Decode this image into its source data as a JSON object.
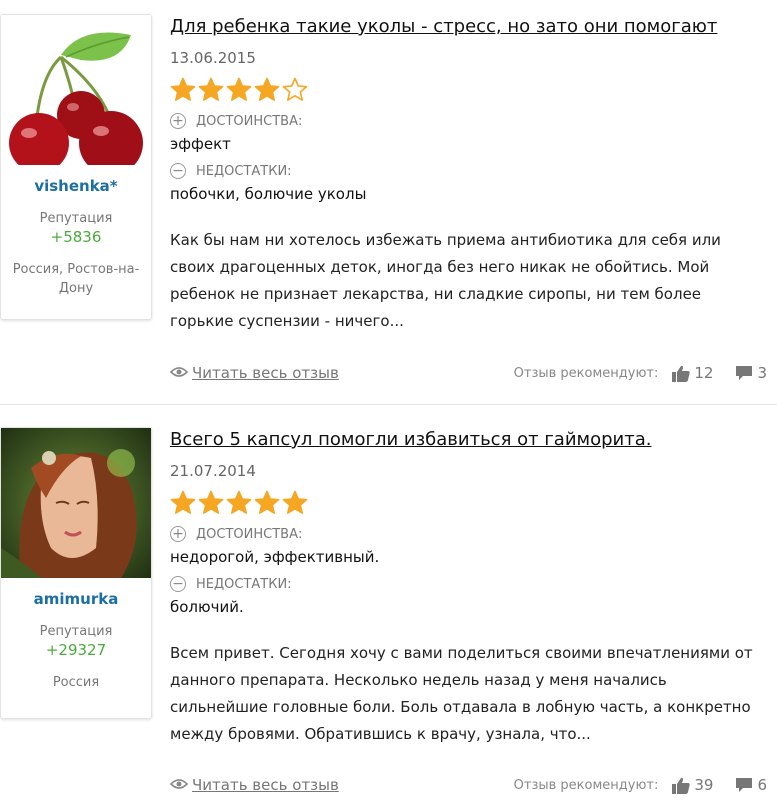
{
  "reviews": [
    {
      "user": {
        "name": "vishenka*",
        "rep_label": "Репутация",
        "rep_value": "+5836",
        "location": "Россия, Ростов-на-Дону",
        "avatar_icon": "cherry-avatar"
      },
      "title": "Для ребенка такие уколы - стресс, но зато они помогают",
      "date": "13.06.2015",
      "rating": 4,
      "rating_max": 5,
      "pros_label": "ДОСТОИНСТВА:",
      "pros": "эффект",
      "cons_label": "НЕДОСТАТКИ:",
      "cons": "побочки, болючие уколы",
      "body": "Как бы нам ни хотелось избежать приема антибиотика для себя или своих драгоценных деток, иногда без него никак не обойтись. Мой ребенок не признает лекарства, ни сладкие сиропы, ни тем более горькие суспензии - ничего...",
      "read_more": "Читать весь отзыв",
      "recommend_label": "Отзыв рекомендуют:",
      "likes": "12",
      "comments": "3"
    },
    {
      "user": {
        "name": "amimurka",
        "rep_label": "Репутация",
        "rep_value": "+29327",
        "location": "Россия",
        "avatar_icon": "portrait-avatar"
      },
      "title": "Всего 5 капсул помогли избавиться от гайморита.",
      "date": "21.07.2014",
      "rating": 5,
      "rating_max": 5,
      "pros_label": "ДОСТОИНСТВА:",
      "pros": "недорогой, эффективный.",
      "cons_label": "НЕДОСТАТКИ:",
      "cons": "болючий.",
      "body": "Всем привет. Сегодня хочу с вами поделиться своими впечатлениями от данного препарата. Несколько недель назад у меня начались сильнейшие головные боли. Боль отдавала в лобную часть, а конкретно между бровями. Обратившись к врачу, узнала, что...",
      "read_more": "Читать весь отзыв",
      "recommend_label": "Отзыв рекомендуют:",
      "likes": "39",
      "comments": "6"
    }
  ],
  "colors": {
    "star": "#f5a623",
    "username": "#1c6fa3",
    "reputation": "#4caa3c"
  }
}
